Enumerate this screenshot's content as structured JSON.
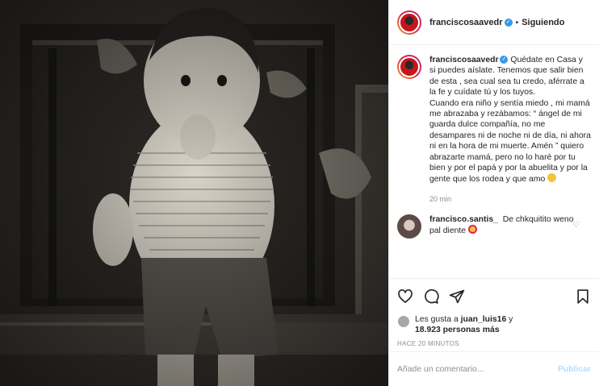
{
  "header": {
    "username": "franciscosaavedr",
    "verified_badge": "✓",
    "separator": "•",
    "follow_status": "Siguiendo"
  },
  "caption": {
    "username": "franciscosaavedr",
    "verified_badge": "✓",
    "para1": "Quédate en Casa y si puedes aíslate. Tenemos que salir bien de esta , sea cual sea tu credo, aférrate a la fe y cuídate tú y los tuyos.",
    "para2": "Cuando era niño y sentía miedo , mi mamá me abrazaba y rezábamos: “ ángel de mi guarda dulce compañía, no me desampares ni de noche ni de día, ni ahora ni en la hora de mi muerte. Amén ” quiero abrazarte mamá, pero no lo haré por tu bien y por el papá y por la abuelita y por la gente que los rodea y que amo",
    "time": "20 min"
  },
  "comment": {
    "username": "francisco.santis_",
    "text": "De chkquitito weno pal diente"
  },
  "likes": {
    "prefix": "Les gusta a",
    "user": "juan_luis16",
    "middle": "y",
    "count": "18.923 personas más"
  },
  "posted_ago": "HACE 20 MINUTOS",
  "add_comment": {
    "placeholder": "Añade un comentario...",
    "publish": "Publicar"
  },
  "colors": {
    "accent": "#3897f0",
    "publish_disabled": "#b2dffc",
    "muted": "#8e8e8e"
  }
}
